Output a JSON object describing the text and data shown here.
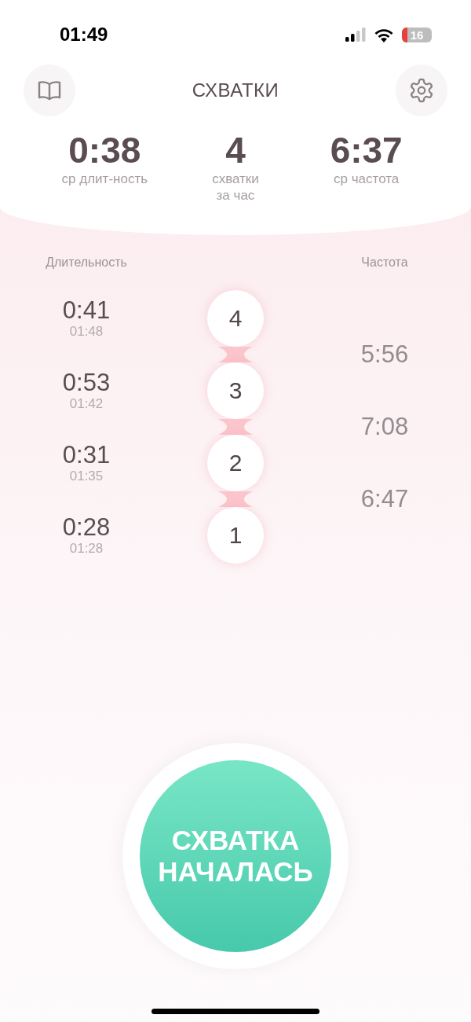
{
  "status_bar": {
    "time": "01:49",
    "battery": "16"
  },
  "header": {
    "title": "СХВАТКИ"
  },
  "stats": [
    {
      "value": "0:38",
      "label": "ср длит-ность"
    },
    {
      "value": "4",
      "label": "схватки\nза час"
    },
    {
      "value": "6:37",
      "label": "ср частота"
    }
  ],
  "columns": {
    "duration": "Длительность",
    "frequency": "Частота"
  },
  "contractions": [
    {
      "number": "4",
      "duration": "0:41",
      "time": "01:48"
    },
    {
      "number": "3",
      "duration": "0:53",
      "time": "01:42"
    },
    {
      "number": "2",
      "duration": "0:31",
      "time": "01:35"
    },
    {
      "number": "1",
      "duration": "0:28",
      "time": "01:28"
    }
  ],
  "intervals": [
    "5:56",
    "7:08",
    "6:47"
  ],
  "start_button": {
    "label": "СХВАТКА\nНАЧАЛАСЬ"
  }
}
